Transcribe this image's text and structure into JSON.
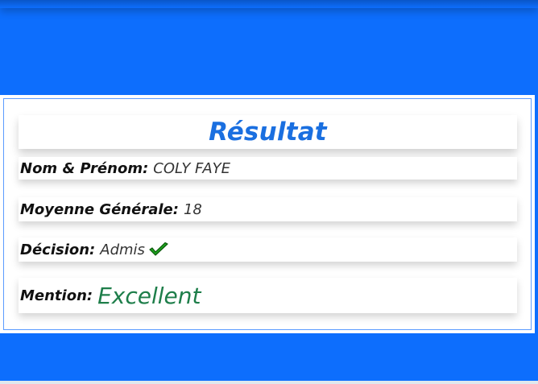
{
  "result": {
    "title": "Résultat",
    "rows": [
      {
        "label": "Nom & Prénom:",
        "value": "COLY FAYE"
      },
      {
        "label": "Moyenne Générale:",
        "value": "18"
      },
      {
        "label": "Décision:",
        "value": "Admis"
      },
      {
        "label": "Mention:",
        "value": "Excellent"
      }
    ]
  },
  "colors": {
    "page_background": "#0d6efd",
    "title": "#1a6fe0",
    "mention": "#1e7e4a",
    "check": "#1fa21f"
  },
  "icons": {
    "decision": "check-icon"
  }
}
